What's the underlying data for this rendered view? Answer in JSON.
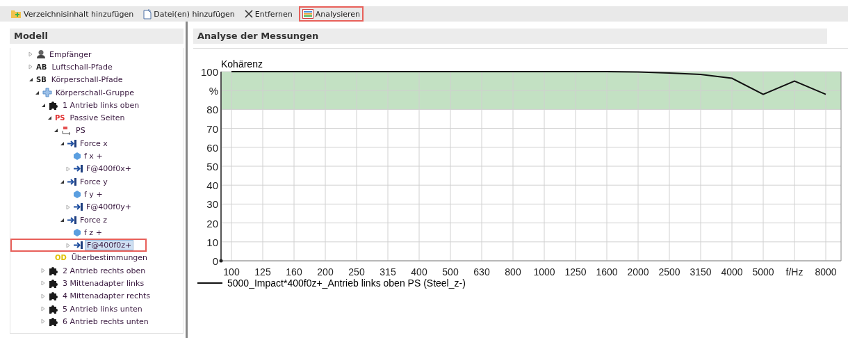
{
  "toolbar": [
    {
      "label": "Verzeichnisinhalt hinzufügen",
      "kind": "folder",
      "highlighted": false
    },
    {
      "label": "Datei(en) hinzufügen",
      "kind": "file",
      "highlighted": false
    },
    {
      "label": "Entfernen",
      "kind": "remove",
      "highlighted": false
    },
    {
      "label": "Analysieren",
      "kind": "analyze",
      "highlighted": true
    }
  ],
  "model_panel": {
    "title": "Modell",
    "tree": [
      {
        "label": "Empfänger",
        "kind": "person",
        "expanded": false,
        "selected": false,
        "highlighted": false
      },
      {
        "label": "Luftschall-Pfade",
        "badge": "AB",
        "color": "#222222",
        "expanded": false,
        "selected": false,
        "highlighted": false
      },
      {
        "label": "Körperschall-Pfade",
        "badge": "SB",
        "color": "#222222",
        "expanded": true,
        "selected": false,
        "highlighted": false,
        "children": [
          {
            "label": "Körperschall-Gruppe",
            "kind": "group",
            "expanded": true,
            "selected": false,
            "highlighted": false,
            "children": [
              {
                "label": "1 Antrieb links oben",
                "kind": "puzzle",
                "expanded": true,
                "selected": false,
                "highlighted": false,
                "children": [
                  {
                    "label": "Passive Seiten",
                    "badge": "PS",
                    "color": "#e03030",
                    "expanded": true,
                    "selected": false,
                    "highlighted": false,
                    "children": [
                      {
                        "label": "PS",
                        "kind": "link",
                        "expanded": true,
                        "selected": false,
                        "highlighted": false,
                        "children": [
                          {
                            "label": "Force x",
                            "kind": "force",
                            "expanded": true,
                            "selected": false,
                            "highlighted": false,
                            "children": [
                              {
                                "label": "f x +",
                                "kind": "drop",
                                "selected": false,
                                "highlighted": false
                              },
                              {
                                "label": "F@400f0x+",
                                "kind": "force",
                                "expanded": false,
                                "selected": false,
                                "highlighted": false
                              }
                            ]
                          },
                          {
                            "label": "Force y",
                            "kind": "force",
                            "expanded": true,
                            "selected": false,
                            "highlighted": false,
                            "children": [
                              {
                                "label": "f y +",
                                "kind": "drop",
                                "selected": false,
                                "highlighted": false
                              },
                              {
                                "label": "F@400f0y+",
                                "kind": "force",
                                "expanded": false,
                                "selected": false,
                                "highlighted": false
                              }
                            ]
                          },
                          {
                            "label": "Force z",
                            "kind": "force",
                            "expanded": true,
                            "selected": false,
                            "highlighted": false,
                            "children": [
                              {
                                "label": "f z +",
                                "kind": "drop",
                                "selected": false,
                                "highlighted": false
                              },
                              {
                                "label": "F@400f0z+",
                                "kind": "force",
                                "expanded": false,
                                "selected": true,
                                "highlighted": true
                              }
                            ]
                          }
                        ]
                      }
                    ]
                  },
                  {
                    "label": "Überbestimmungen",
                    "badge": "OD",
                    "color": "#e0c000",
                    "selected": false,
                    "highlighted": false
                  }
                ]
              },
              {
                "label": "2 Antrieb rechts oben",
                "kind": "puzzle",
                "expanded": false,
                "selected": false,
                "highlighted": false
              },
              {
                "label": "3 Mittenadapter links",
                "kind": "puzzle",
                "expanded": false,
                "selected": false,
                "highlighted": false
              },
              {
                "label": "4 Mittenadapter rechts",
                "kind": "puzzle",
                "expanded": false,
                "selected": false,
                "highlighted": false
              },
              {
                "label": "5 Antrieb links unten",
                "kind": "puzzle",
                "expanded": false,
                "selected": false,
                "highlighted": false
              },
              {
                "label": "6 Antrieb rechts unten",
                "kind": "puzzle",
                "expanded": false,
                "selected": false,
                "highlighted": false
              }
            ]
          }
        ]
      }
    ]
  },
  "analysis_panel": {
    "title": "Analyse der Messungen",
    "chart_data": {
      "type": "line",
      "title": "Kohärenz",
      "categories": [
        "100",
        "125",
        "160",
        "200",
        "250",
        "315",
        "400",
        "500",
        "630",
        "800",
        "1000",
        "1250",
        "1600",
        "2000",
        "2500",
        "3150",
        "4000",
        "5000",
        "f/Hz",
        "8000"
      ],
      "series": [
        {
          "name": "5000_Impact*400f0z+_Antrieb links oben PS (Steel_z-)",
          "color": "#111111",
          "values": [
            100,
            100,
            100,
            100,
            100,
            100,
            100,
            100,
            100,
            100,
            100,
            100,
            100,
            99.8,
            99.3,
            98.5,
            96.5,
            88,
            95,
            88
          ]
        }
      ],
      "ylim": [
        0,
        100
      ],
      "yticks": [
        0,
        10,
        20,
        30,
        40,
        50,
        60,
        70,
        80,
        {
          "value": 90,
          "label": "%"
        },
        100
      ],
      "grid": true,
      "bands": [
        {
          "axis": "y",
          "from": 80,
          "to": 100,
          "color": "#c3e1c3"
        }
      ]
    }
  }
}
